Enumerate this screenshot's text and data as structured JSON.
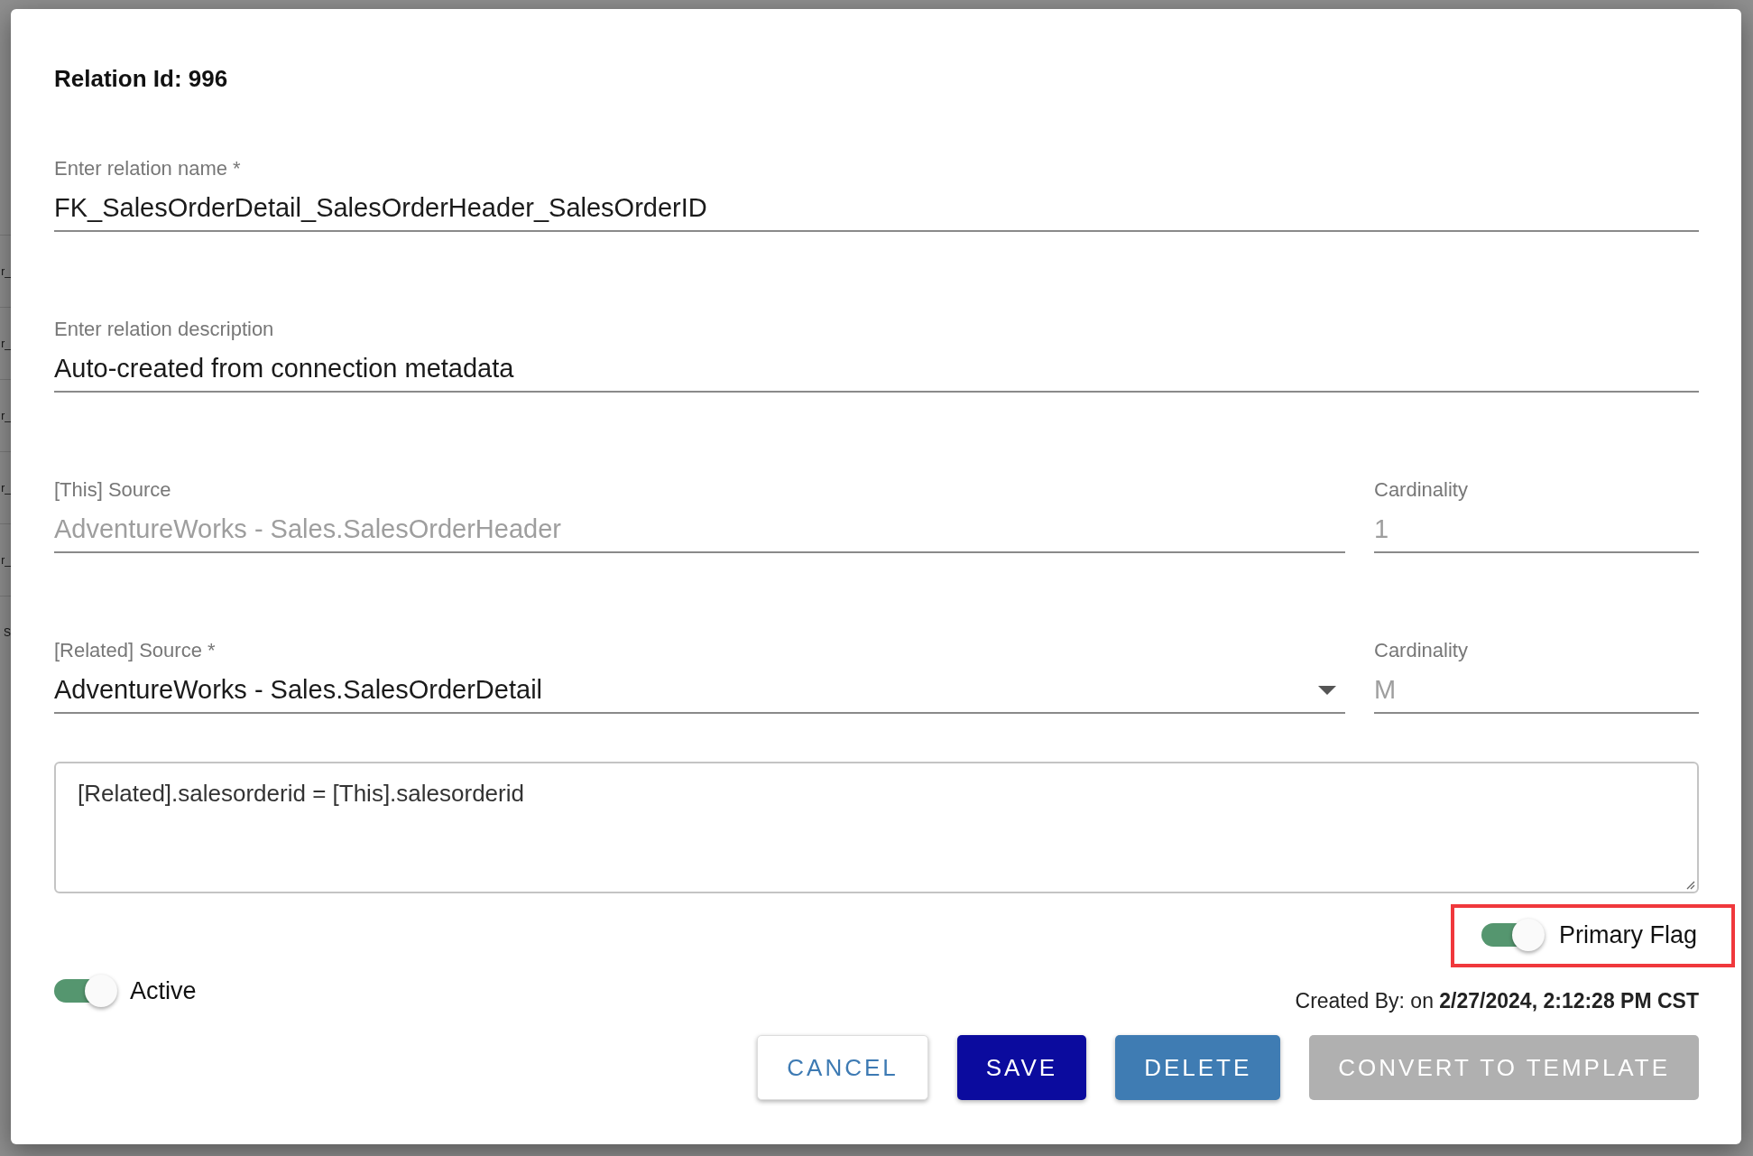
{
  "background_rows": [
    "r_",
    "r_",
    "r_",
    "r_",
    "r_",
    "S"
  ],
  "dialog": {
    "title": "Relation Id: 996",
    "fields": [
      {
        "label": "Enter relation name *",
        "value": "FK_SalesOrderDetail_SalesOrderHeader_SalesOrderID",
        "disabled": false
      },
      {
        "label": "Enter relation description",
        "value": "Auto-created from connection metadata",
        "disabled": false
      }
    ],
    "source_rows": [
      {
        "source": {
          "kind": "text",
          "label": "[This] Source",
          "value": "AdventureWorks - Sales.SalesOrderHeader",
          "disabled": true
        },
        "cardinality": {
          "label": "Cardinality",
          "value": "1",
          "disabled": true
        }
      },
      {
        "source": {
          "kind": "select",
          "label": "[Related] Source *",
          "value": "AdventureWorks - Sales.SalesOrderDetail",
          "disabled": false
        },
        "cardinality": {
          "label": "Cardinality",
          "value": "M",
          "disabled": true
        }
      }
    ],
    "expression": "[Related].salesorderid = [This].salesorderid",
    "primary_flag": {
      "label": "Primary Flag",
      "on": true,
      "highlighted": true
    },
    "active": {
      "label": "Active",
      "on": true
    },
    "created_by": "Created By: on **2/27/2024, 2:12:28 PM CST**",
    "buttons": [
      {
        "kind": "outlined",
        "label": "CANCEL"
      },
      {
        "kind": "primary",
        "label": "SAVE"
      },
      {
        "kind": "secondary",
        "label": "DELETE"
      },
      {
        "kind": "disabled",
        "label": "CONVERT TO TEMPLATE"
      }
    ]
  }
}
